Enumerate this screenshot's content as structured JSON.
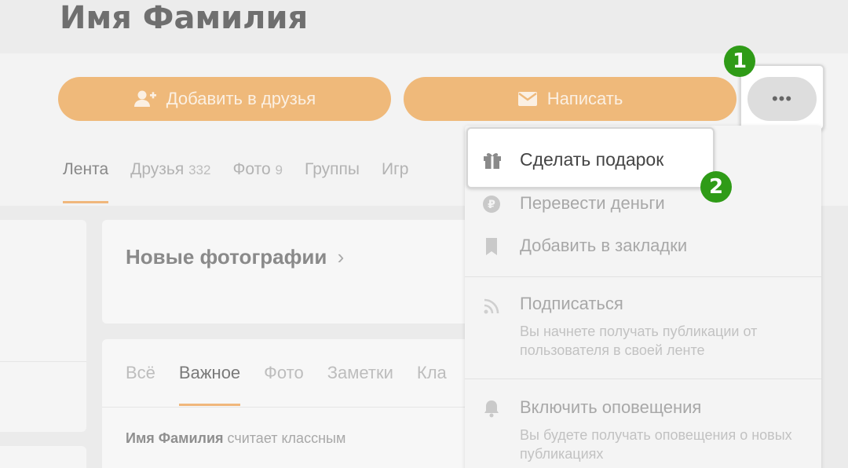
{
  "profile": {
    "name": "Имя Фамилия"
  },
  "actions": {
    "add_friend_label": "Добавить в друзья",
    "write_label": "Написать",
    "more_label": "•••"
  },
  "badges": {
    "one": "1",
    "two": "2"
  },
  "tabs": [
    {
      "label": "Лента",
      "count": ""
    },
    {
      "label": "Друзья",
      "count": "332"
    },
    {
      "label": "Фото",
      "count": "9"
    },
    {
      "label": "Группы",
      "count": ""
    },
    {
      "label": "Игр",
      "count": ""
    }
  ],
  "photos": {
    "title": "Новые фотографии",
    "chevron": "›"
  },
  "feed": {
    "tabs": [
      "Всё",
      "Важное",
      "Фото",
      "Заметки",
      "Кла"
    ],
    "item_author": "Имя Фамилия",
    "item_text": "считает классным"
  },
  "menu": {
    "gift": "Сделать подарок",
    "transfer": "Перевести деньги",
    "bookmark": "Добавить в закладки",
    "subscribe": "Подписаться",
    "subscribe_desc": "Вы начнете получать публикации от пользователя в своей ленте",
    "notify": "Включить оповещения",
    "notify_desc": "Вы будете получать оповещения о новых публикациях"
  },
  "colors": {
    "accent_orange": "#efb97a",
    "badge_green": "#2f9b17",
    "tab_underline": "#f0b77c"
  }
}
